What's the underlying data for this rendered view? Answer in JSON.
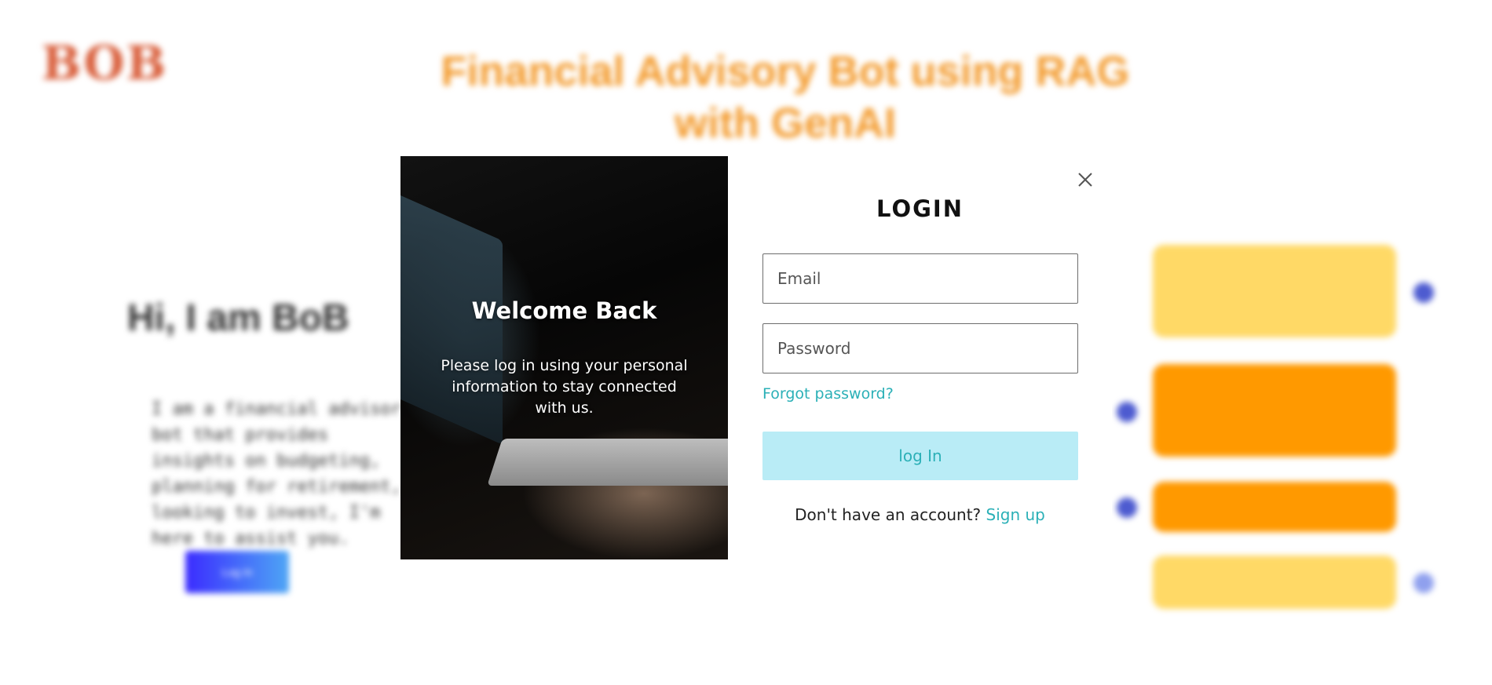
{
  "background": {
    "logo_text": "BOB",
    "logo_subtext": "",
    "site_title": "Financial Advisory Bot using RAG with GenAI",
    "hero_title": "Hi, I am BoB",
    "hero_description": "I am a financial advisor bot that provides insights on budgeting, planning for retirement, looking to invest, I'm here to assist you.",
    "cta_label": "Log In",
    "bubble_colors": [
      "#ffd966",
      "#ff9900",
      "#ff9900",
      "#ffd966"
    ],
    "dot_color": "#4d5bd0"
  },
  "modal": {
    "hero": {
      "title": "Welcome Back",
      "subtitle": "Please log in using your personal information to stay connected with us."
    },
    "form": {
      "title": "LOGIN",
      "email_placeholder": "Email",
      "password_placeholder": "Password",
      "forgot_password": "Forgot password?",
      "submit_label": "log In",
      "signup_prompt": "Don't have an account?",
      "signup_link": "Sign up"
    },
    "close_icon": "close-icon"
  },
  "colors": {
    "accent": "#2bb0b7",
    "button_bg": "#b9ecf6",
    "title_orange": "#f39a2c",
    "logo_red": "#d9603d"
  }
}
